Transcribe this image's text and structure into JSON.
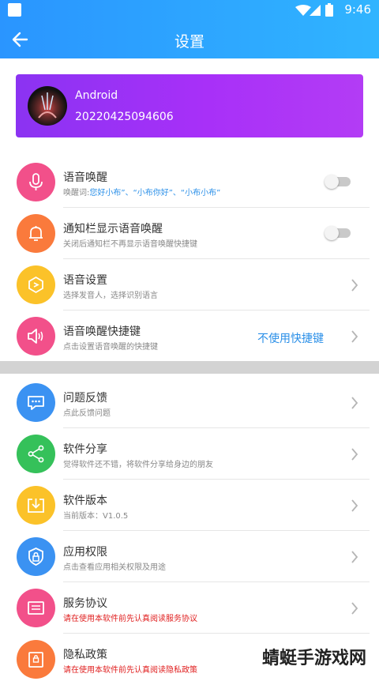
{
  "status": {
    "time": "9:46"
  },
  "header": {
    "title": "设置"
  },
  "profile": {
    "name": "Android",
    "id": "20220425094606"
  },
  "section1": [
    {
      "label": "语音唤醒",
      "sub_prefix": "唤醒词:",
      "sub_highlight": "您好小布”、“小布你好”、“小布小布”",
      "control": "toggle",
      "color": "#f2508a",
      "icon": "microphone-icon"
    },
    {
      "label": "通知栏显示语音唤醒",
      "sub": "关闭后通知栏不再显示语音唤醒快捷键",
      "control": "toggle",
      "color": "#fa7a3c",
      "icon": "bell-icon"
    },
    {
      "label": "语音设置",
      "sub": "选择发音人，选择识别语言",
      "control": "chevron",
      "color": "#fbc229",
      "icon": "voice-settings-icon"
    },
    {
      "label": "语音唤醒快捷键",
      "sub": "点击设置语音唤醒的快捷键",
      "control": "chevron",
      "right_text": "不使用快捷键",
      "color": "#f2508a",
      "icon": "speaker-icon"
    }
  ],
  "section2": [
    {
      "label": "问题反馈",
      "sub": "点此反馈问题",
      "color": "#3b92f2",
      "icon": "feedback-icon"
    },
    {
      "label": "软件分享",
      "sub": "觉得软件还不错，将软件分享给身边的朋友",
      "color": "#35c15a",
      "icon": "share-icon"
    },
    {
      "label": "软件版本",
      "sub": "当前版本：V1.0.5",
      "color": "#fbc229",
      "icon": "download-icon"
    },
    {
      "label": "应用权限",
      "sub": "点击查看应用相关权限及用途",
      "color": "#3b92f2",
      "icon": "lock-shield-icon"
    },
    {
      "label": "服务协议",
      "sub": "请在使用本软件前先认真阅读服务协议",
      "sub_red": true,
      "color": "#f2508a",
      "icon": "document-icon"
    },
    {
      "label": "隐私政策",
      "sub": "请在使用本软件前先认真阅读隐私政策",
      "sub_red": true,
      "color": "#fa7a3c",
      "icon": "privacy-icon"
    }
  ],
  "watermark": "蜻蜓手游戏网"
}
